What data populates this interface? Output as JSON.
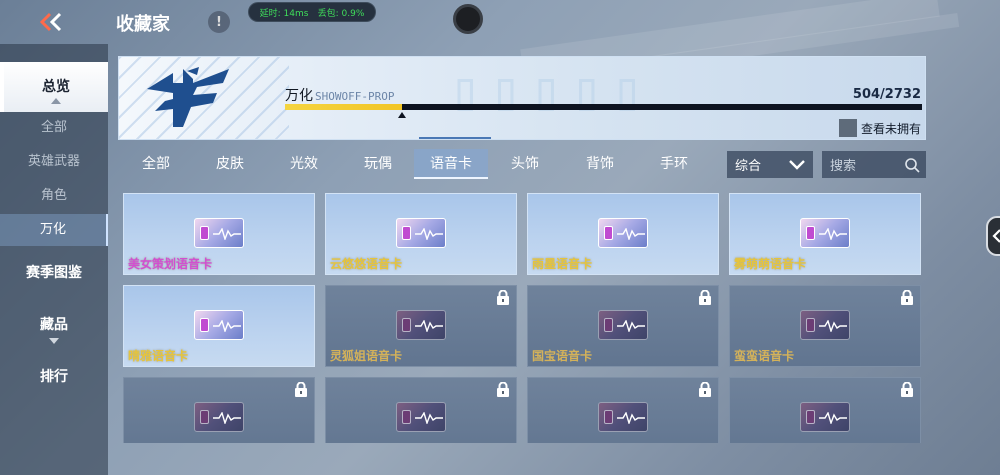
{
  "header": {
    "title": "收藏家",
    "alert_icon": "!",
    "net": {
      "latency_label": "延时:",
      "latency_value": "14ms",
      "loss_label": "丢包:",
      "loss_value": "0.9%"
    }
  },
  "sidebar": {
    "overview": "总览",
    "sub_items": [
      "全部",
      "英雄武器",
      "角色",
      "万化"
    ],
    "active_sub": "万化",
    "main_items": [
      "赛季图鉴",
      "藏品",
      "排行"
    ]
  },
  "banner": {
    "name": "万化",
    "subtitle": "SHOWOFF-PROP",
    "owned": 504,
    "total": 2732,
    "count_text": "504/2732",
    "progress_fraction": 0.184,
    "not_owned_label": "查看未拥有"
  },
  "tabs": {
    "items": [
      "全部",
      "皮肤",
      "光效",
      "玩偶",
      "语音卡",
      "头饰",
      "背饰",
      "手环"
    ],
    "active": "语音卡"
  },
  "sort": {
    "value": "综合"
  },
  "search": {
    "placeholder": "搜索"
  },
  "cards": [
    {
      "name": "美女策划语音卡",
      "owned": true,
      "color": "pink"
    },
    {
      "name": "云悠悠语音卡",
      "owned": true,
      "color": "gold"
    },
    {
      "name": "雨墨语音卡",
      "owned": true,
      "color": "gold"
    },
    {
      "name": "雾萌萌语音卡",
      "owned": true,
      "color": "gold"
    },
    {
      "name": "晴雅语音卡",
      "owned": true,
      "color": "gold"
    },
    {
      "name": "灵狐姐语音卡",
      "owned": false,
      "color": "gold"
    },
    {
      "name": "国宝语音卡",
      "owned": false,
      "color": "gold"
    },
    {
      "name": "蛮蛮语音卡",
      "owned": false,
      "color": "gold"
    },
    {
      "name": "",
      "owned": false,
      "color": "gold"
    },
    {
      "name": "",
      "owned": false,
      "color": "gold"
    },
    {
      "name": "",
      "owned": false,
      "color": "gold"
    },
    {
      "name": "",
      "owned": false,
      "color": "gold"
    }
  ],
  "colors": {
    "progress": "#f2c526",
    "accent_pink": "#d24fd0",
    "accent_gold": "#e6c43c"
  }
}
